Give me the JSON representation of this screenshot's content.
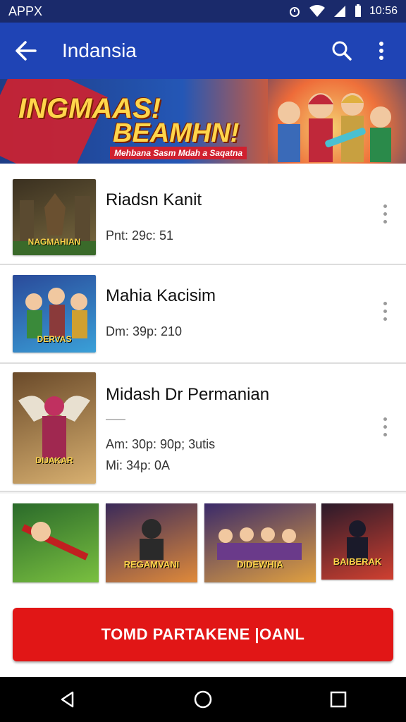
{
  "status_bar": {
    "app_name": "APPX",
    "time": "10:56"
  },
  "app_bar": {
    "title": "Indansia"
  },
  "banner": {
    "headline_1": "INGMAAS!",
    "headline_2": "BEAMHN!",
    "subtitle": "Mehbana Sasm Mdah a Saqatna"
  },
  "items": [
    {
      "title": "Riadsn Kanit",
      "meta_1": "Pnt: 29c: 51",
      "thumb_caption": "NAGMAHIAN",
      "colors": [
        "#3a3020",
        "#7a6a40"
      ]
    },
    {
      "title": "Mahia Kacisim",
      "meta_1": "Dm: 39p: 210",
      "thumb_caption": "DERVAS",
      "colors": [
        "#2a4a9a",
        "#3aa0d8"
      ]
    },
    {
      "title": "Midash Dr Permanian",
      "meta_1": "Am: 30p: 90p; 3utis",
      "meta_2": "Mi: 34p: 0A",
      "thumb_caption": "DIJAKAR",
      "colors": [
        "#6a4a2a",
        "#d8b070"
      ]
    }
  ],
  "strip": [
    {
      "caption": "",
      "colors": [
        "#2a6a2a",
        "#7ac040"
      ]
    },
    {
      "caption": "REGAMVANI",
      "colors": [
        "#3a2a5a",
        "#e08a3a"
      ]
    },
    {
      "caption": "DIDEWHIA",
      "colors": [
        "#3a2a6a",
        "#e0a040"
      ]
    },
    {
      "caption": "BAIBERAK",
      "colors": [
        "#2a1a2a",
        "#d04030"
      ]
    }
  ],
  "cta": {
    "label": "TOMD PARTAKENE |OANL"
  },
  "theme": {
    "primary": "#1f44b5",
    "status": "#1a2a6b",
    "accent": "#e11616"
  }
}
